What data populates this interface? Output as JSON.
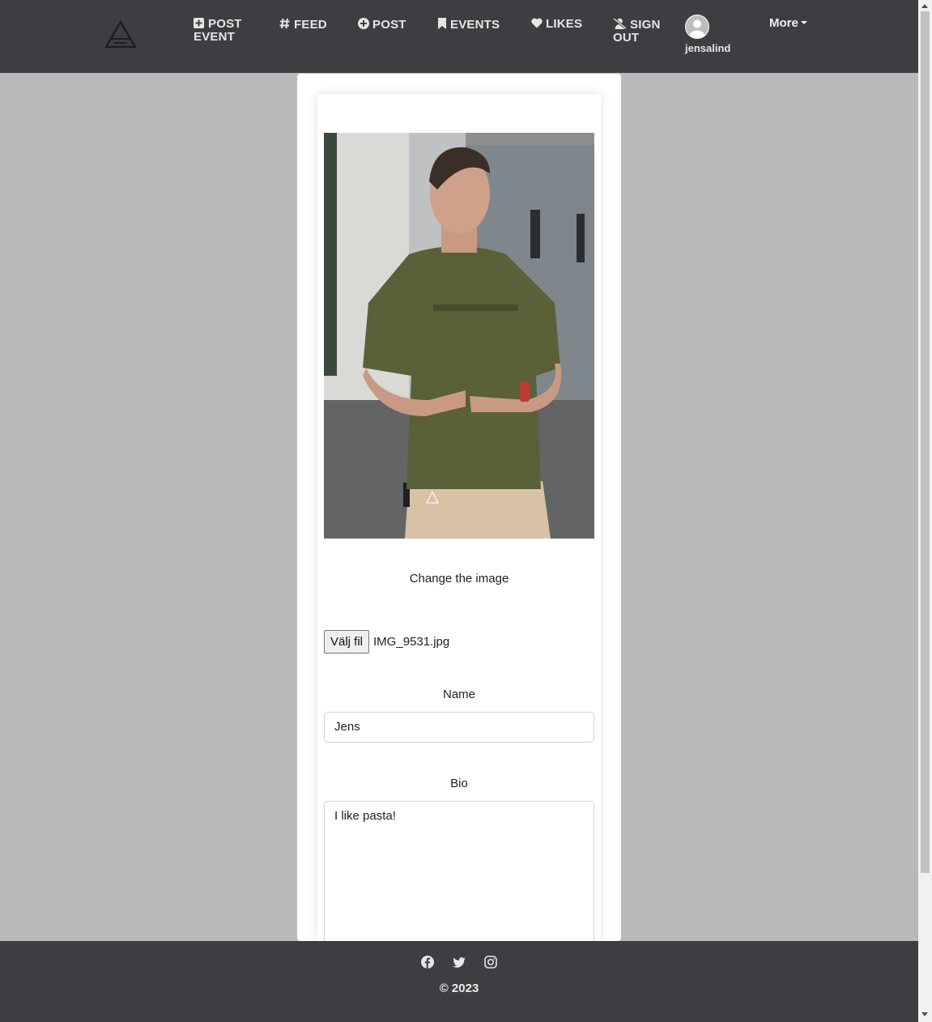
{
  "navbar": {
    "logo": "triangle-logo-icon",
    "items": [
      {
        "label": "POST\nEVENT",
        "icon": "plus-square-icon"
      },
      {
        "label": "FEED",
        "icon": "hashtag-icon"
      },
      {
        "label": "POST",
        "icon": "plus-circle-icon"
      },
      {
        "label": "EVENTS",
        "icon": "bookmark-icon"
      },
      {
        "label": "LIKES",
        "icon": "heart-icon"
      },
      {
        "label": "SIGN\nOUT",
        "icon": "user-slash-icon"
      }
    ],
    "username": "jensalind",
    "more_label": "More"
  },
  "form": {
    "change_image_label": "Change the image",
    "file_button_label": "Välj fil",
    "file_name": "IMG_9531.jpg",
    "name_label": "Name",
    "name_value": "Jens",
    "bio_label": "Bio",
    "bio_value": "I like pasta!"
  },
  "footer": {
    "social_icons": [
      "facebook-icon",
      "twitter-icon",
      "instagram-icon"
    ],
    "copyright": "© 2023"
  },
  "colors": {
    "navbar_bg": "#3d3e42",
    "page_bg": "#b9b9bb",
    "card_bg": "#ffffff"
  }
}
